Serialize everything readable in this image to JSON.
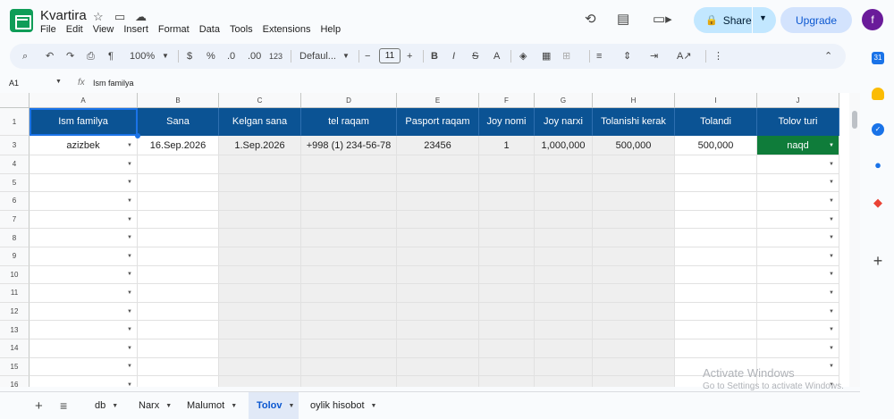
{
  "document": {
    "title": "Kvartira",
    "menu": [
      "File",
      "Edit",
      "View",
      "Insert",
      "Format",
      "Data",
      "Tools",
      "Extensions",
      "Help"
    ]
  },
  "header": {
    "share_label": "Share",
    "upgrade_label": "Upgrade",
    "avatar_letter": "f"
  },
  "toolbar": {
    "zoom": "100%",
    "currency": "$",
    "percent": "%",
    "dec_decrease": ".0",
    "dec_increase": ".00",
    "number_format": "123",
    "font": "Defaul...",
    "font_size": "11"
  },
  "formula_bar": {
    "cell_ref": "A1",
    "fx": "fx",
    "content": "Ism familya"
  },
  "grid": {
    "columns": [
      "A",
      "B",
      "C",
      "D",
      "E",
      "F",
      "G",
      "H",
      "I",
      "J"
    ],
    "row_numbers": [
      "1",
      "3",
      "4",
      "5",
      "6",
      "7",
      "8",
      "9",
      "10",
      "11",
      "12",
      "13",
      "14",
      "15",
      "16"
    ],
    "header_row": [
      "Ism familya",
      "Sana",
      "Kelgan sana",
      "tel raqam",
      "Pasport raqam",
      "Joy nomi",
      "Joy narxi",
      "Tolanishi kerak",
      "Tolandi",
      "Tolov turi"
    ],
    "data_row": [
      "azizbek",
      "16.Sep.2026",
      "1.Sep.2026",
      "+998 (1) 234-56-78",
      "23456",
      "1",
      "1,000,000",
      "500,000",
      "500,000",
      "naqd"
    ],
    "status_color": "#0f7c3a",
    "header_color": "#0b5394"
  },
  "sheet_tabs": [
    {
      "label": "db",
      "active": false
    },
    {
      "label": "Narx",
      "active": false
    },
    {
      "label": "Malumot",
      "active": false
    },
    {
      "label": "Tolov",
      "active": true
    },
    {
      "label": "oylik hisobot",
      "active": false
    }
  ],
  "watermark": {
    "line1": "Activate Windows",
    "line2": "Go to Settings to activate Windows."
  }
}
